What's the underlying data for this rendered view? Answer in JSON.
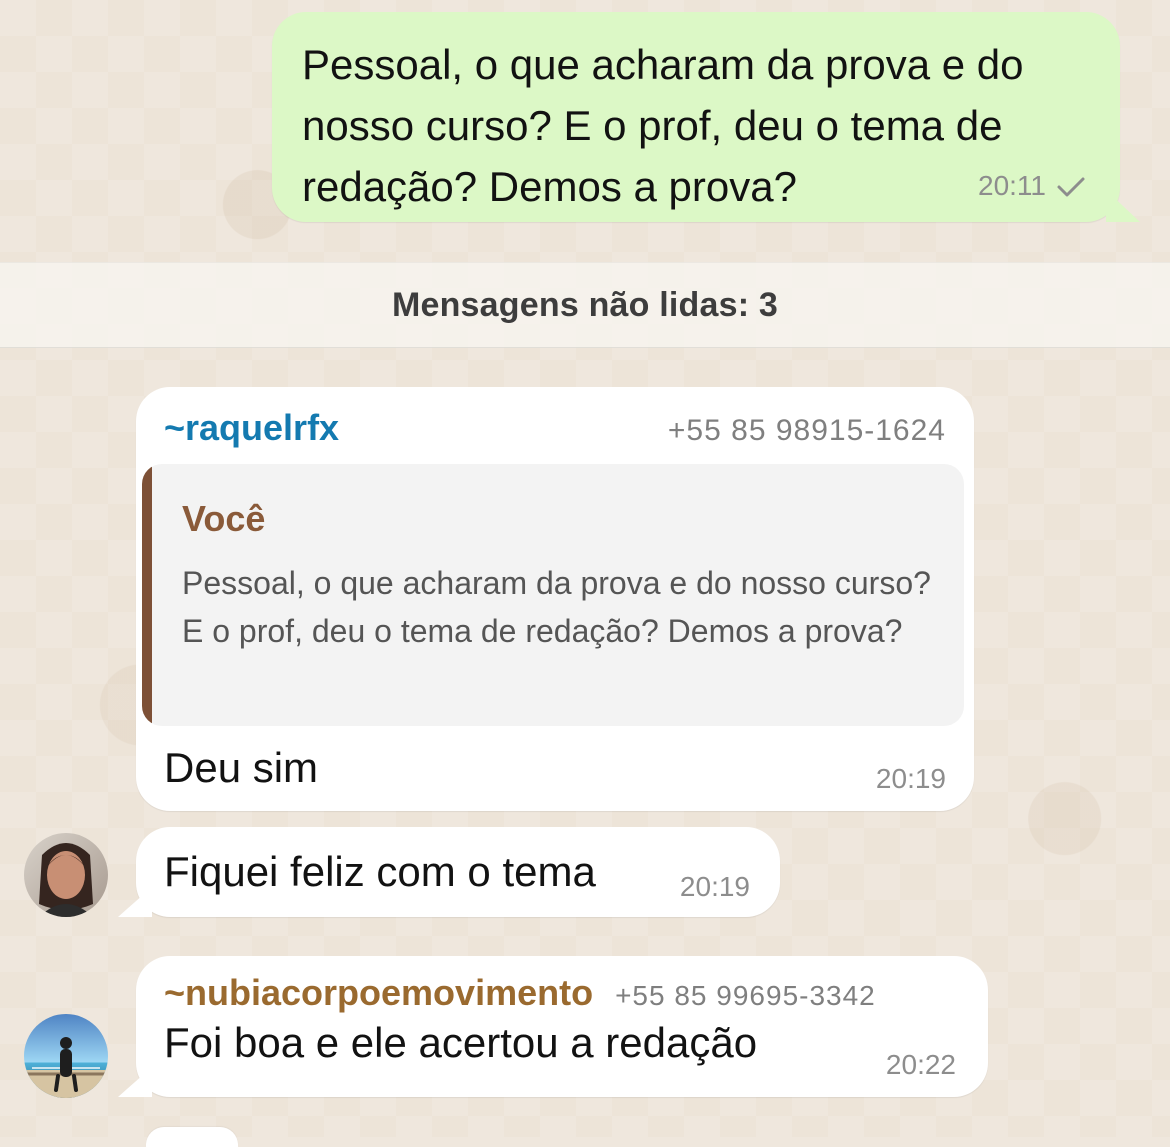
{
  "colors": {
    "background": "#efe7dd",
    "outgoing_bubble": "#dcf8c6",
    "incoming_bubble": "#ffffff",
    "banner_background": "#f5f2ec",
    "quote_background": "#f3f3f3",
    "quote_accent": "#7d5036",
    "sender_blue": "#147ab0",
    "sender_brown": "#9a6a2f",
    "timestamp": "#8d8d8d"
  },
  "outgoing_message": {
    "text": "Pessoal, o que acharam da prova e do nosso curso? E o prof, deu o tema de redação? Demos a prova?",
    "time": "20:11",
    "status_icon": "check-icon"
  },
  "unread_banner": {
    "text": "Mensagens não lidas: 3"
  },
  "messages": [
    {
      "sender": "~raquelrfx",
      "phone": "+55 85 98915-1624",
      "quote": {
        "author": "Você",
        "text": "Pessoal, o que acharam da prova e do nosso curso? E o prof, deu o tema de redação? Demos a prova?"
      },
      "text": "Deu sim",
      "time": "20:19"
    },
    {
      "text": "Fiquei feliz com o tema",
      "time": "20:19",
      "avatar_icon": "user-avatar-icon"
    },
    {
      "sender": "~nubiacorpoemovimento",
      "phone": "+55 85 99695-3342",
      "text": "Foi boa e ele acertou a redação",
      "time": "20:22",
      "avatar_icon": "user-avatar-icon"
    }
  ]
}
